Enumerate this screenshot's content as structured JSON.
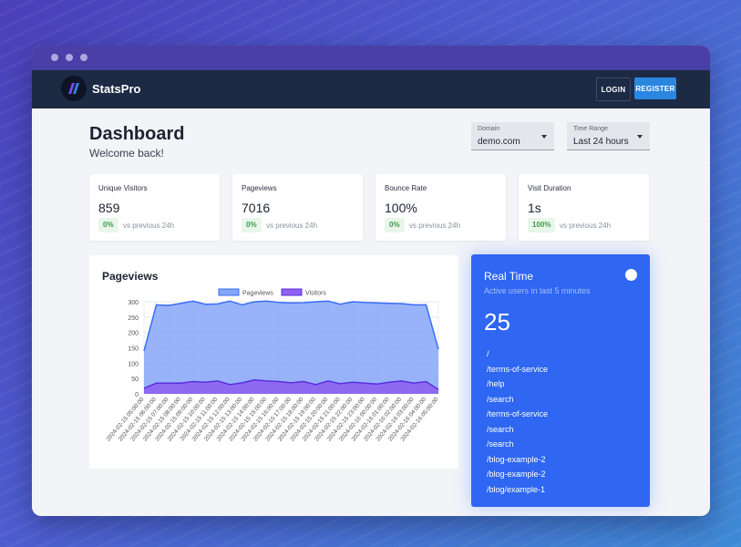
{
  "app": {
    "brand": "StatsPro"
  },
  "navbar": {
    "login_label": "LOGIN",
    "register_label": "REGISTER"
  },
  "header": {
    "title": "Dashboard",
    "subtitle": "Welcome back!"
  },
  "filters": {
    "domain": {
      "label": "Domain",
      "value": "demo.com"
    },
    "time_range": {
      "label": "Time Range",
      "value": "Last 24 hours"
    }
  },
  "stats": [
    {
      "title": "Unique Visitors",
      "value": "859",
      "delta": "0%",
      "compare": "vs previous 24h"
    },
    {
      "title": "Pageviews",
      "value": "7016",
      "delta": "0%",
      "compare": "vs previous 24h"
    },
    {
      "title": "Bounce Rate",
      "value": "100%",
      "delta": "0%",
      "compare": "vs previous 24h"
    },
    {
      "title": "Visit Duration",
      "value": "1s",
      "delta": "100%",
      "compare": "vs previous 24h"
    }
  ],
  "chart_panel": {
    "title": "Pageviews"
  },
  "chart_data": {
    "type": "area",
    "title": "",
    "xlabel": "",
    "ylabel": "",
    "ylim": [
      0,
      300
    ],
    "yticks": [
      0,
      50,
      100,
      150,
      200,
      250,
      300
    ],
    "legend_position": "top",
    "grid": true,
    "x": [
      "2024-02-15 05:00:00",
      "2024-02-15 06:00:00",
      "2024-02-15 07:00:00",
      "2024-02-15 08:00:00",
      "2024-02-15 09:00:00",
      "2024-02-15 10:00:00",
      "2024-02-15 11:00:00",
      "2024-02-15 12:00:00",
      "2024-02-15 13:00:00",
      "2024-02-15 14:00:00",
      "2024-02-15 15:00:00",
      "2024-02-15 16:00:00",
      "2024-02-15 17:00:00",
      "2024-02-15 18:00:00",
      "2024-02-15 19:00:00",
      "2024-02-15 20:00:00",
      "2024-02-15 21:00:00",
      "2024-02-15 22:00:00",
      "2024-02-15 23:00:00",
      "2024-02-16 00:00:00",
      "2024-02-16 01:00:00",
      "2024-02-16 02:00:00",
      "2024-02-16 03:00:00",
      "2024-02-16 04:00:00",
      "2024-02-16 05:00:00"
    ],
    "series": [
      {
        "name": "Pageviews",
        "color": "#3b6ef5",
        "fill": "#86a6f8",
        "values": [
          140,
          290,
          288,
          295,
          302,
          292,
          293,
          302,
          290,
          300,
          302,
          298,
          296,
          297,
          300,
          302,
          292,
          300,
          298,
          296,
          295,
          294,
          290,
          290,
          145
        ]
      },
      {
        "name": "Visitors",
        "color": "#5a2ee0",
        "fill": "#8d62f0",
        "values": [
          18,
          35,
          35,
          35,
          40,
          38,
          42,
          30,
          36,
          45,
          42,
          40,
          36,
          40,
          30,
          42,
          33,
          38,
          35,
          32,
          38,
          42,
          35,
          40,
          14
        ]
      }
    ]
  },
  "realtime": {
    "title": "Real Time",
    "subtitle": "Active users in last 5 minutes",
    "count": "25",
    "pages": [
      "/",
      "/terms-of-service",
      "/help",
      "/search",
      "/terms-of-service",
      "/search",
      "/search",
      "/blog-example-2",
      "/blog-example-2",
      "/blog/example-1"
    ]
  },
  "colors": {
    "accent": "#2b86e0",
    "navbar": "#1d2a44",
    "realtime_bg": "#2f66f2",
    "positive": "#3d9a46"
  }
}
